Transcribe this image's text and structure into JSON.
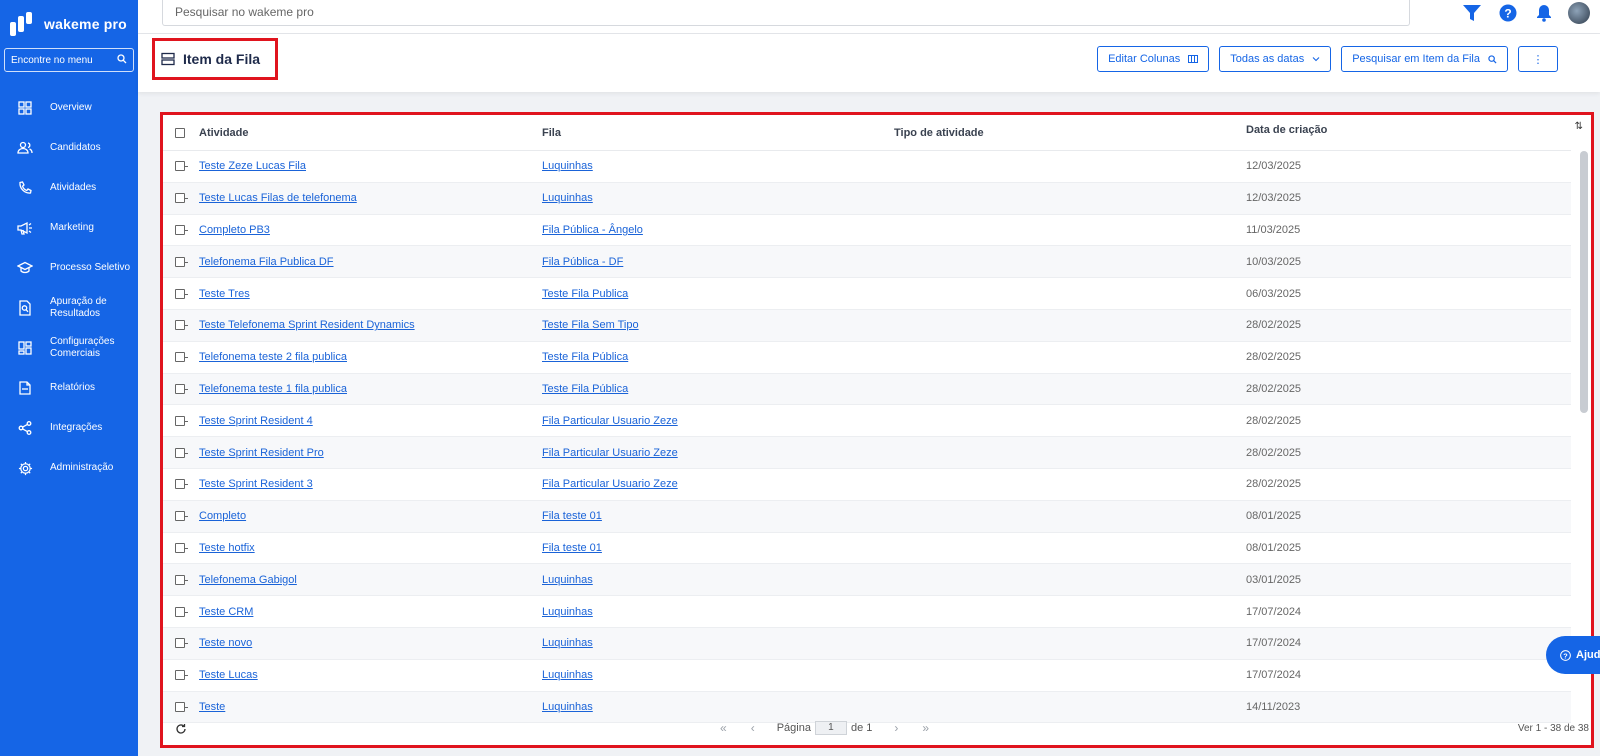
{
  "brand": {
    "name": "wakeme pro"
  },
  "sidebar": {
    "search_placeholder": "Encontre no menu",
    "items": [
      {
        "label": "Overview",
        "icon": "grid-icon"
      },
      {
        "label": "Candidatos",
        "icon": "users-icon"
      },
      {
        "label": "Atividades",
        "icon": "phone-icon"
      },
      {
        "label": "Marketing",
        "icon": "megaphone-icon"
      },
      {
        "label": "Processo Seletivo",
        "icon": "graduation-cap-icon"
      },
      {
        "label": "Apuração de\nResultados",
        "icon": "search-document-icon"
      },
      {
        "label": "Configurações\nComerciais",
        "icon": "dashboard-icon"
      },
      {
        "label": "Relatórios",
        "icon": "file-icon"
      },
      {
        "label": "Integrações",
        "icon": "share-icon"
      },
      {
        "label": "Administração",
        "icon": "gear-icon"
      }
    ]
  },
  "topbar": {
    "search_placeholder": "Pesquisar no wakeme pro"
  },
  "header": {
    "title": "Item da Fila",
    "buttons": {
      "edit_columns": "Editar Colunas",
      "all_dates": "Todas as datas",
      "search": "Pesquisar em Item da Fila",
      "more": "⋮"
    }
  },
  "table": {
    "columns": {
      "activity": "Atividade",
      "queue": "Fila",
      "type": "Tipo de atividade",
      "created": "Data de criação"
    },
    "rows": [
      {
        "activity": "Teste Zeze Lucas Fila",
        "queue": "Luquinhas",
        "type": "",
        "created": "12/03/2025"
      },
      {
        "activity": "Teste Lucas Filas de telefonema",
        "queue": "Luquinhas",
        "type": "",
        "created": "12/03/2025"
      },
      {
        "activity": "Completo PB3",
        "queue": "Fila Pública - Ângelo",
        "type": "",
        "created": "11/03/2025"
      },
      {
        "activity": "Telefonema Fila Publica DF",
        "queue": "Fila Pública - DF",
        "type": "",
        "created": "10/03/2025"
      },
      {
        "activity": "Teste Tres",
        "queue": "Teste Fila Publica",
        "type": "",
        "created": "06/03/2025"
      },
      {
        "activity": "Teste Telefonema Sprint Resident Dynamics",
        "queue": "Teste Fila Sem Tipo",
        "type": "",
        "created": "28/02/2025"
      },
      {
        "activity": "Telefonema teste 2 fila publica",
        "queue": "Teste Fila Pública",
        "type": "",
        "created": "28/02/2025"
      },
      {
        "activity": "Telefonema teste 1 fila publica",
        "queue": "Teste Fila Pública",
        "type": "",
        "created": "28/02/2025"
      },
      {
        "activity": "Teste Sprint Resident 4",
        "queue": "Fila Particular Usuario Zeze",
        "type": "",
        "created": "28/02/2025"
      },
      {
        "activity": "Teste Sprint Resident Pro",
        "queue": "Fila Particular Usuario Zeze",
        "type": "",
        "created": "28/02/2025"
      },
      {
        "activity": "Teste Sprint Resident 3",
        "queue": "Fila Particular Usuario Zeze",
        "type": "",
        "created": "28/02/2025"
      },
      {
        "activity": "Completo",
        "queue": "Fila teste 01",
        "type": "",
        "created": "08/01/2025"
      },
      {
        "activity": "Teste hotfix",
        "queue": "Fila teste 01",
        "type": "",
        "created": "08/01/2025"
      },
      {
        "activity": "Telefonema Gabigol",
        "queue": "Luquinhas",
        "type": "",
        "created": "03/01/2025"
      },
      {
        "activity": "Teste CRM",
        "queue": "Luquinhas",
        "type": "",
        "created": "17/07/2024"
      },
      {
        "activity": "Teste novo",
        "queue": "Luquinhas",
        "type": "",
        "created": "17/07/2024"
      },
      {
        "activity": "Teste Lucas",
        "queue": "Luquinhas",
        "type": "",
        "created": "17/07/2024"
      },
      {
        "activity": "Teste",
        "queue": "Luquinhas",
        "type": "",
        "created": "14/11/2023"
      }
    ],
    "footer": {
      "page_label": "Página",
      "page_value": "1",
      "of_label": "de 1",
      "record_count": "Ver 1 - 38 de 38"
    }
  },
  "help": {
    "label": "Ajuda"
  },
  "colors": {
    "primary": "#1565e6",
    "link": "#1a63d8",
    "highlight": "#e0141e"
  }
}
